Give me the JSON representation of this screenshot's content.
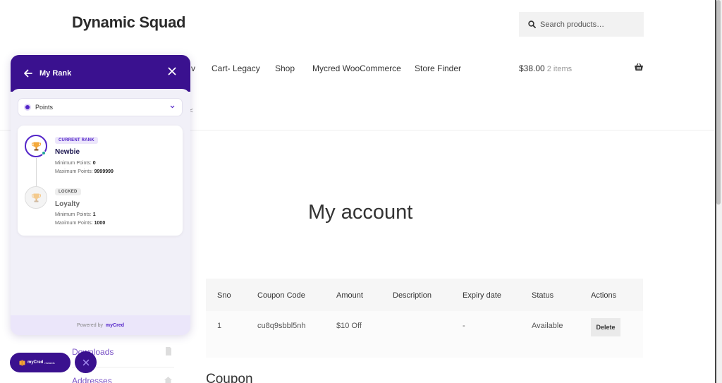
{
  "site": {
    "title": "Dynamic Squad"
  },
  "search": {
    "placeholder": "Search products…"
  },
  "nav": {
    "items": [
      "Cart- Legacy",
      "Shop",
      "Mycred WooCommerce",
      "Store Finder"
    ],
    "peek_fragment": "v",
    "peek_fragment_2": "<"
  },
  "cart": {
    "amount": "$38.00",
    "items": "2 items"
  },
  "page": {
    "title": "My account",
    "coupon_heading": "Coupon"
  },
  "account_nav": {
    "items": [
      "Downloads",
      "Addresses"
    ]
  },
  "coupon_table": {
    "headers": [
      "Sno",
      "Coupon Code",
      "Amount",
      "Description",
      "Expiry date",
      "Status",
      "Actions"
    ],
    "rows": [
      {
        "sno": "1",
        "code": "cu8q9sbbl5nh",
        "amount": "$10 Off",
        "description": "",
        "expiry": "-",
        "status": "Available",
        "action": "Delete"
      }
    ]
  },
  "rank_panel": {
    "title": "My Rank",
    "select_value": "Points",
    "ranks": [
      {
        "tag": "CURRENT RANK",
        "name": "Newbie",
        "min_label": "Minimum Points:",
        "min": "0",
        "max_label": "Maximum Points:",
        "max": "9999999",
        "state": "current"
      },
      {
        "tag": "LOCKED",
        "name": "Loyalty",
        "min_label": "Minimum Points:",
        "min": "1",
        "max_label": "Maximum Points:",
        "max": "1000",
        "state": "locked"
      }
    ],
    "footer_prefix": "Powered by",
    "footer_brand": "myCred",
    "accent_color": "#3a118f"
  },
  "mycred_pill": {
    "logo": "myCred",
    "sub": "rewards"
  },
  "icons": [
    "search-icon",
    "basket-icon",
    "back-arrow-icon",
    "close-icon",
    "chevron-down-icon",
    "trophy-icon",
    "file-icon",
    "home-icon"
  ]
}
